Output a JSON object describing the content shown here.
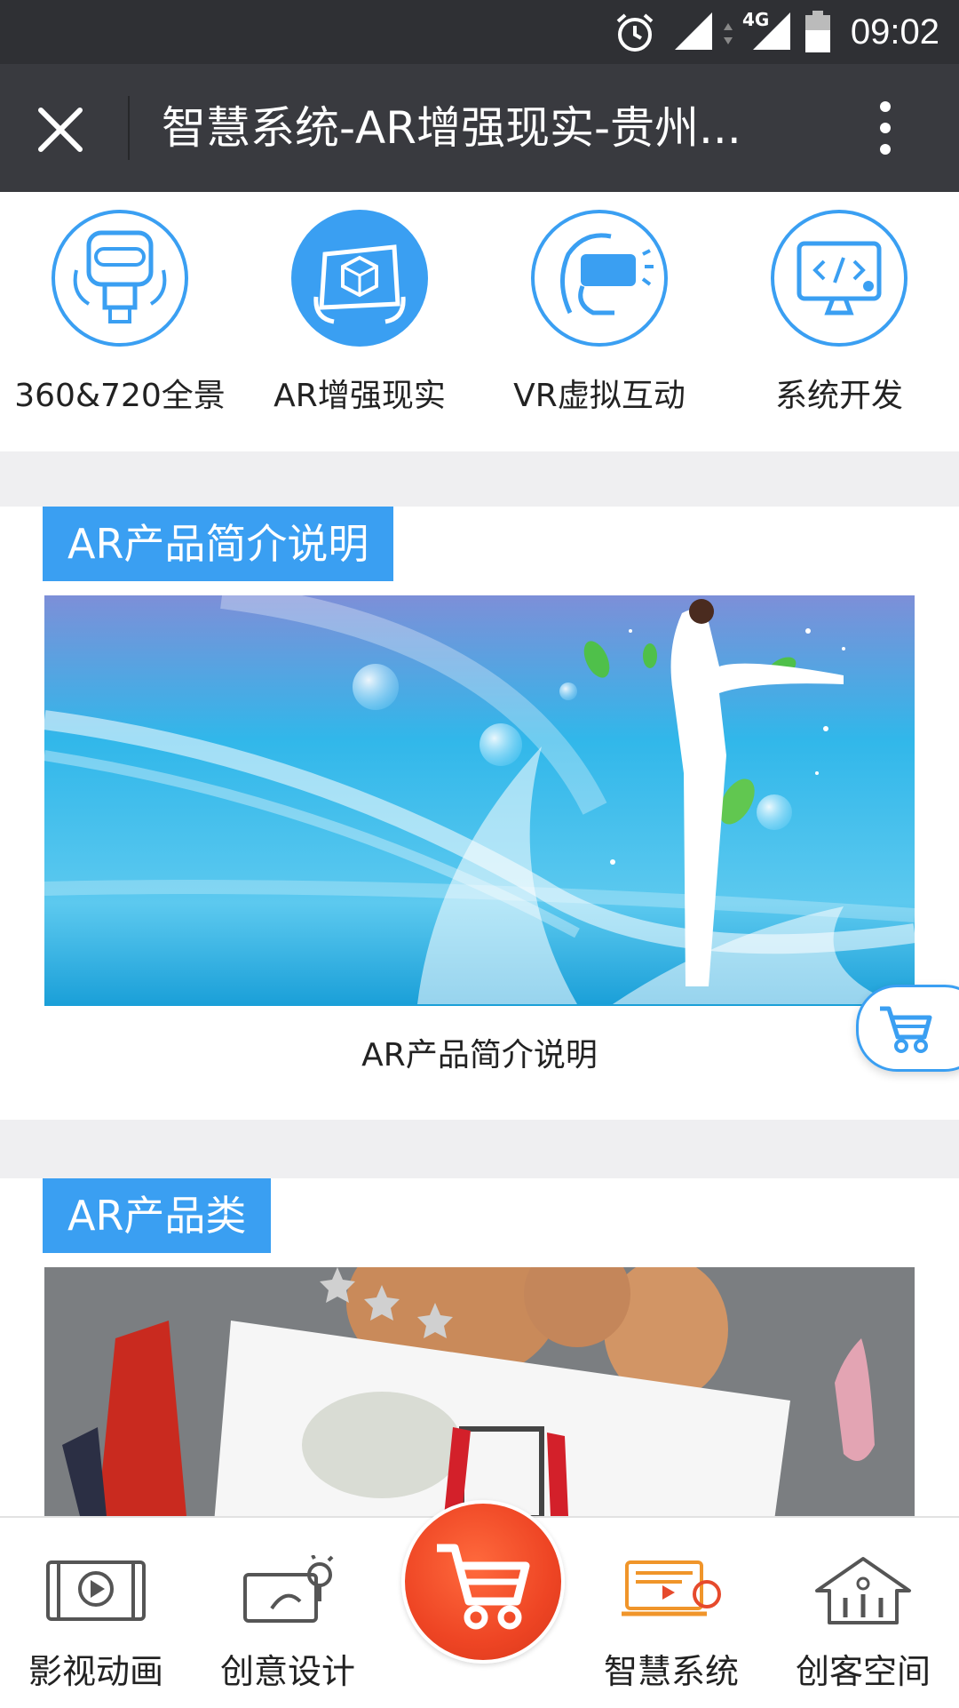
{
  "status_bar": {
    "time": "09:02",
    "network": "4G"
  },
  "title_bar": {
    "title": "智慧系统-AR增强现实-贵州..."
  },
  "categories": [
    {
      "label": "360&720全景",
      "icon": "panorama-vr-icon"
    },
    {
      "label": "AR增强现实",
      "icon": "ar-tablet-icon"
    },
    {
      "label": "VR虚拟互动",
      "icon": "vr-headset-icon"
    },
    {
      "label": "系统开发",
      "icon": "code-monitor-icon"
    }
  ],
  "sections": [
    {
      "tag": "AR产品简介说明",
      "caption": "AR产品简介说明"
    },
    {
      "tag": "AR产品类"
    }
  ],
  "tab_bar": [
    {
      "label": "影视动画",
      "icon": "film-animation-icon"
    },
    {
      "label": "创意设计",
      "icon": "creative-design-icon"
    },
    {
      "label": "",
      "icon": "cart-icon"
    },
    {
      "label": "智慧系统",
      "icon": "smart-system-icon"
    },
    {
      "label": "创客空间",
      "icon": "maker-space-icon"
    }
  ],
  "colors": {
    "accent": "#3a9ff2",
    "cart": "#ee4524",
    "title_bar": "#393a3f",
    "status_bar": "#2f3034"
  }
}
